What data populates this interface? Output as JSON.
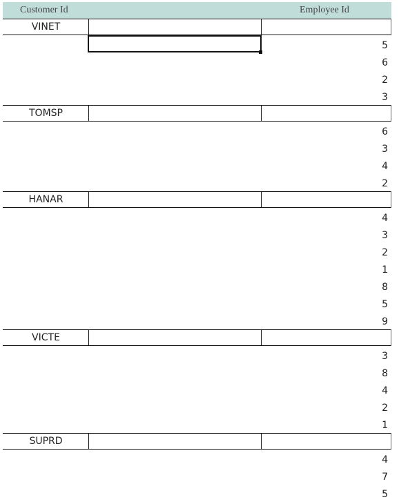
{
  "header": {
    "customer_id": "Customer Id",
    "employee_id": "Employee Id"
  },
  "groups": [
    {
      "customer": "VINET",
      "employees": [
        "5",
        "6",
        "2",
        "3"
      ]
    },
    {
      "customer": "TOMSP",
      "employees": [
        "6",
        "3",
        "4",
        "2"
      ]
    },
    {
      "customer": "HANAR",
      "employees": [
        "4",
        "3",
        "2",
        "1",
        "8",
        "5",
        "9"
      ]
    },
    {
      "customer": "VICTE",
      "employees": [
        "3",
        "8",
        "4",
        "2",
        "1"
      ]
    },
    {
      "customer": "SUPRD",
      "employees": [
        "4",
        "7",
        "5"
      ]
    }
  ]
}
